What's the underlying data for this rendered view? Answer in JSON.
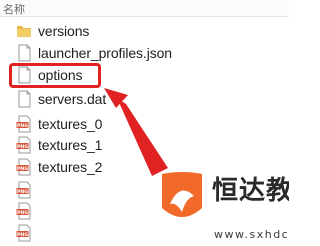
{
  "column_header": {
    "name": "名称"
  },
  "files": [
    {
      "name": "versions",
      "icon": "folder-icon"
    },
    {
      "name": "launcher_profiles.json",
      "icon": "document-icon"
    },
    {
      "name": "options",
      "icon": "document-icon",
      "highlighted": true
    },
    {
      "name": "servers.dat",
      "icon": "document-icon"
    },
    {
      "name": "textures_0",
      "icon": "png-file-icon"
    },
    {
      "name": "textures_1",
      "icon": "png-file-icon"
    },
    {
      "name": "textures_2",
      "icon": "png-file-icon"
    },
    {
      "name": "",
      "icon": "png-file-icon"
    },
    {
      "name": "",
      "icon": "png-file-icon"
    },
    {
      "name": "",
      "icon": "png-file-icon"
    }
  ],
  "annotation": {
    "color": "#e02222"
  },
  "watermark": {
    "title": "恒达教程网",
    "domain": "www.sxhdcj.com",
    "logo_colors": [
      "#f26a2a",
      "#e23b3b"
    ]
  }
}
